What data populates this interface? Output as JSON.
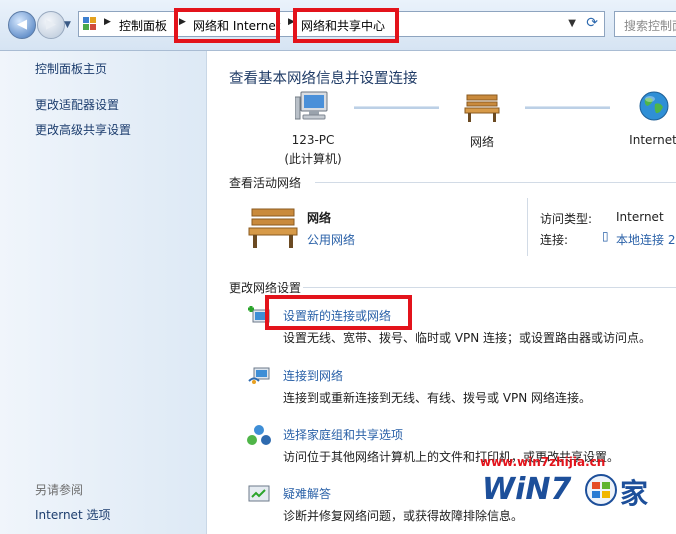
{
  "address": {
    "crumbs": [
      "控制面板",
      "网络和 Internet",
      "网络和共享中心"
    ],
    "search_placeholder": "搜索控制面"
  },
  "sidebar": {
    "items": [
      "控制面板主页",
      "更改适配器设置",
      "更改高级共享设置"
    ],
    "see_also_heading": "另请参阅",
    "see_also": [
      "Internet 选项"
    ]
  },
  "main": {
    "title": "查看基本网络信息并设置连接",
    "map": {
      "pc_name": "123-PC",
      "pc_sub": "(此计算机)",
      "network": "网络",
      "internet": "Internet"
    },
    "active_heading": "查看活动网络",
    "active": {
      "name": "网络",
      "type": "公用网络",
      "access_label": "访问类型:",
      "access_value": "Internet",
      "conn_label": "连接:",
      "conn_value": "本地连接 2"
    },
    "change_heading": "更改网络设置",
    "tasks": [
      {
        "title": "设置新的连接或网络",
        "desc": "设置无线、宽带、拨号、临时或 VPN 连接；或设置路由器或访问点。"
      },
      {
        "title": "连接到网络",
        "desc": "连接到或重新连接到无线、有线、拨号或 VPN 网络连接。"
      },
      {
        "title": "选择家庭组和共享选项",
        "desc": "访问位于其他网络计算机上的文件和打印机，或更改共享设置。"
      },
      {
        "title": "疑难解答",
        "desc": "诊断并修复网络问题，或获得故障排除信息。"
      }
    ]
  },
  "watermark": {
    "url": "www.win7zhijia.cn",
    "brand": "WiN7",
    "suffix": "家"
  },
  "colors": {
    "highlight": "#e3131b",
    "link": "#2a61a8"
  }
}
